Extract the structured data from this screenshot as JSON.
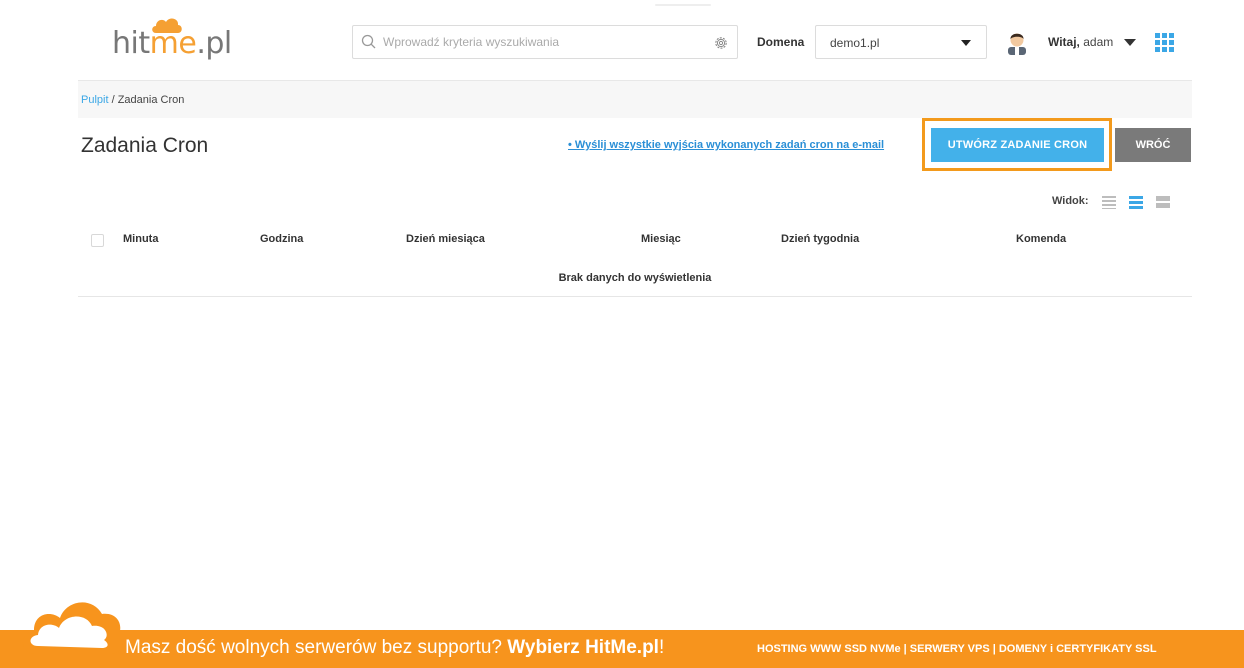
{
  "brand": {
    "logo_prefix": "hit",
    "logo_accent": "me",
    "logo_suffix": ".pl"
  },
  "header": {
    "search_placeholder": "Wprowadź kryteria wyszukiwania",
    "domain_label": "Domena",
    "domain_value": "demo1.pl",
    "welcome_bold": "Witaj,",
    "welcome_user": " adam"
  },
  "breadcrumb": {
    "home": "Pulpit",
    "separator": " / ",
    "current": "Zadania Cron"
  },
  "page": {
    "title": "Zadania Cron",
    "email_link": "• Wyślij wszystkie wyjścia wykonanych zadań cron na e-mail",
    "create_button": "UTWÓRZ ZADANIE CRON",
    "back_button": "WRÓĆ",
    "view_label": "Widok:"
  },
  "table": {
    "columns": [
      "Minuta",
      "Godzina",
      "Dzień miesiąca",
      "Miesiąc",
      "Dzień tygodnia",
      "Komenda"
    ],
    "empty_message": "Brak danych do wyświetlenia"
  },
  "footer": {
    "text_plain": "Masz dość wolnych serwerów bez supportu? ",
    "text_bold": "Wybierz HitMe.pl",
    "text_end": "!",
    "right": "HOSTING WWW SSD NVMe | SERWERY VPS | DOMENY i CERTYFIKATY SSL"
  },
  "colors": {
    "accent": "#3ba7e6",
    "orange": "#f7941d",
    "highlight": "#f39a1c"
  }
}
